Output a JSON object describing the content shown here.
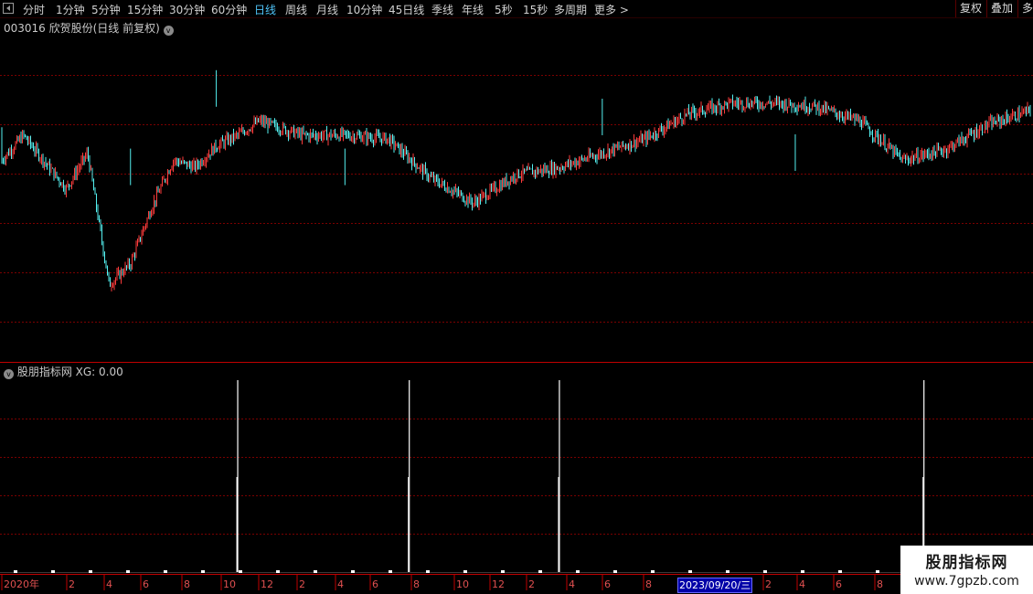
{
  "toolbar": {
    "periods": [
      "分时",
      "1分钟",
      "5分钟",
      "15分钟",
      "30分钟",
      "60分钟",
      "日线",
      "周线",
      "月线",
      "10分钟",
      "45日线",
      "季线",
      "年线",
      "5秒",
      "15秒",
      "多周期",
      "更多 >"
    ],
    "active_period": "日线",
    "fuquan": "复权",
    "diejia": "叠加",
    "duo": "多"
  },
  "main_title": "003016 欣贺股份(日线 前复权)",
  "indicator_title": "股朋指标网 XG: 0.00",
  "xaxis": {
    "labels": [
      "2020年",
      "2",
      "4",
      "6",
      "8",
      "10",
      "12",
      "2",
      "4",
      "6",
      "8",
      "10",
      "12",
      "2",
      "4",
      "6",
      "8",
      "2",
      "4",
      "6",
      "8"
    ],
    "cursor_date": "2023/09/20/三"
  },
  "watermark": {
    "title": "股朋指标网",
    "url": "www.7gpzb.com"
  },
  "colors": {
    "up": "#ff3b3b",
    "down": "#54f0f0",
    "grid": "#7a0000",
    "border": "#c00000"
  },
  "chart_data": [
    {
      "type": "candlestick",
      "symbol": "003016",
      "name": "欣贺股份",
      "period": "日线",
      "adjust": "前复权",
      "close_trend": [
        {
          "month": "2020-10",
          "close": 265
        },
        {
          "month": "2020-11",
          "close": 300
        },
        {
          "month": "2021-01",
          "close": 225
        },
        {
          "month": "2021-02",
          "close": 275
        },
        {
          "month": "2021-03",
          "close": 90
        },
        {
          "month": "2021-04",
          "close": 120
        },
        {
          "month": "2021-05",
          "close": 200
        },
        {
          "month": "2021-06",
          "close": 265
        },
        {
          "month": "2021-07",
          "close": 255
        },
        {
          "month": "2021-08",
          "close": 285
        },
        {
          "month": "2021-09",
          "close": 300
        },
        {
          "month": "2021-10",
          "close": 320
        },
        {
          "month": "2021-12",
          "close": 300
        },
        {
          "month": "2022-02",
          "close": 300
        },
        {
          "month": "2022-04",
          "close": 295
        },
        {
          "month": "2022-06",
          "close": 240
        },
        {
          "month": "2022-08",
          "close": 205
        },
        {
          "month": "2022-10",
          "close": 245
        },
        {
          "month": "2022-12",
          "close": 255
        },
        {
          "month": "2023-02",
          "close": 275
        },
        {
          "month": "2023-04",
          "close": 295
        },
        {
          "month": "2023-06",
          "close": 330
        },
        {
          "month": "2023-08",
          "close": 345
        },
        {
          "month": "2023-10",
          "close": 345
        },
        {
          "month": "2023-12",
          "close": 340
        },
        {
          "month": "2024-02",
          "close": 320
        },
        {
          "month": "2024-04",
          "close": 265
        },
        {
          "month": "2024-06",
          "close": 280
        },
        {
          "month": "2024-08",
          "close": 315
        },
        {
          "month": "2024-10",
          "close": 335
        }
      ]
    },
    {
      "type": "bar",
      "name": "XG",
      "current_value": 0.0,
      "signals": [
        {
          "month": "2021-09",
          "value": 1
        },
        {
          "month": "2022-05",
          "value": 1
        },
        {
          "month": "2022-12",
          "value": 1
        },
        {
          "month": "2024-05",
          "value": 1
        }
      ]
    }
  ]
}
